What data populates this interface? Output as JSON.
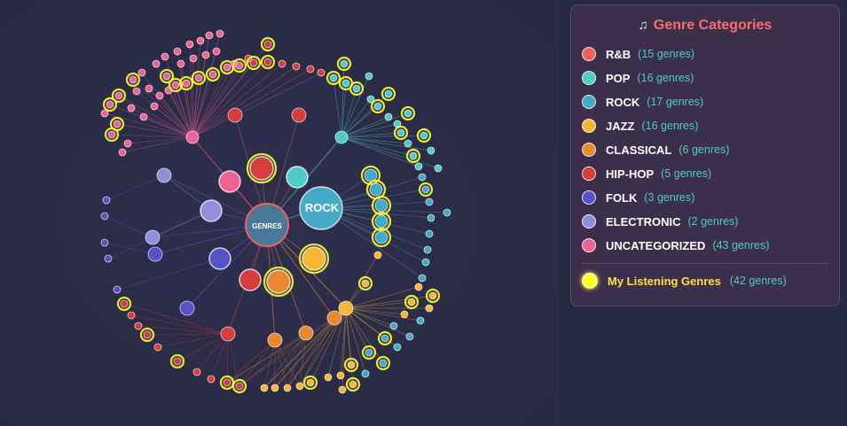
{
  "graph": {
    "center_label": "GENRES",
    "rock_label": "ROCK"
  },
  "legend": {
    "icon": "music-note-icon",
    "title": "Genre Categories",
    "items": [
      {
        "label": "R&B",
        "count": "(15 genres)",
        "color": "#f25f5c"
      },
      {
        "label": "POP",
        "count": "(16 genres)",
        "color": "#4ecdc4"
      },
      {
        "label": "ROCK",
        "count": "(17 genres)",
        "color": "#45aac6"
      },
      {
        "label": "JAZZ",
        "count": "(16 genres)",
        "color": "#f7b733"
      },
      {
        "label": "CLASSICAL",
        "count": "(6 genres)",
        "color": "#e8892e"
      },
      {
        "label": "HIP-HOP",
        "count": "(5 genres)",
        "color": "#d63d3d"
      },
      {
        "label": "FOLK",
        "count": "(3 genres)",
        "color": "#5454c8"
      },
      {
        "label": "ELECTRONIC",
        "count": "(2 genres)",
        "color": "#8f8fde"
      },
      {
        "label": "UNCATEGORIZED",
        "count": "(43 genres)",
        "color": "#f06292"
      }
    ],
    "listening": {
      "label": "My Listening Genres",
      "count": "(42 genres)",
      "color": "#ffff22"
    }
  }
}
